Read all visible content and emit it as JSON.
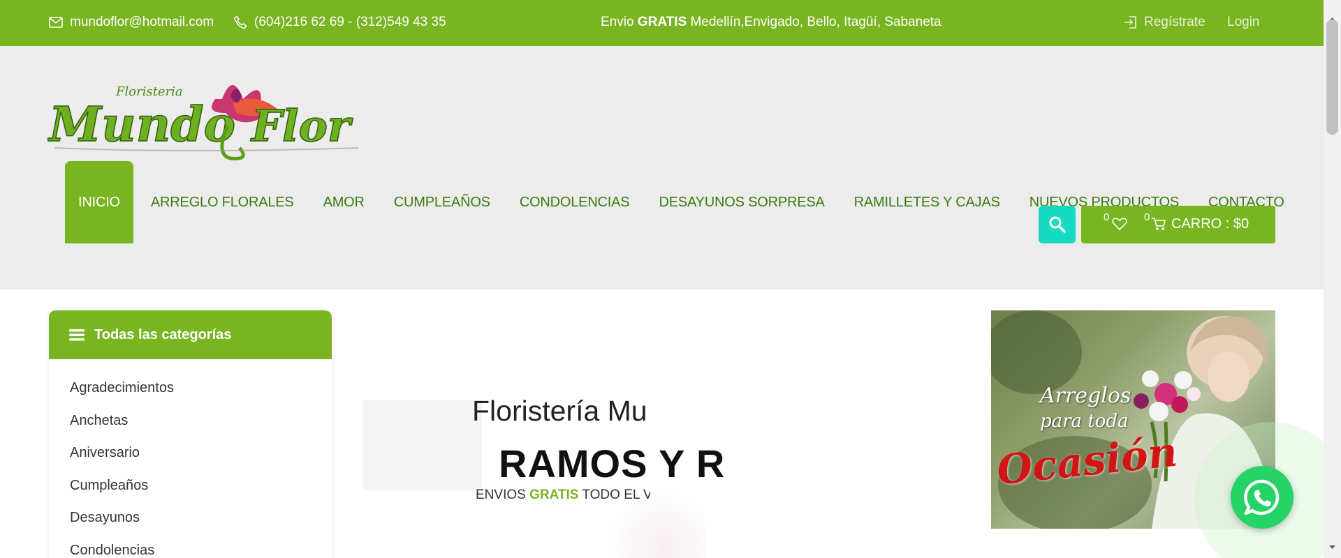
{
  "topbar": {
    "email": "mundoflor@hotmail.com",
    "phone": "(604)216 62 69 - (312)549 43 35",
    "shipping_prefix": "Envio ",
    "shipping_bold": "GRATIS",
    "shipping_rest": " Medellín,Envigado, Bello, Itagüí, Sabaneta",
    "register": "Regístrate",
    "login": "Login"
  },
  "logo": {
    "small": "Floristeria",
    "main_left": "Mundo",
    "main_right": "Flor"
  },
  "nav": {
    "items": [
      {
        "label": "INICIO",
        "active": true
      },
      {
        "label": "ARREGLO FLORALES"
      },
      {
        "label": "AMOR"
      },
      {
        "label": "CUMPLEAÑOS"
      },
      {
        "label": "CONDOLENCIAS"
      },
      {
        "label": "DESAYUNOS SORPRESA"
      },
      {
        "label": "RAMILLETES Y CAJAS"
      },
      {
        "label": "NUEVOS PRODUCTOS"
      },
      {
        "label": "CONTACTO"
      }
    ]
  },
  "cart": {
    "wishlist_count": "0",
    "cart_count": "0",
    "label": "CARRO : $0"
  },
  "categories": {
    "title": "Todas las categorías",
    "items": [
      "Agradecimientos",
      "Anchetas",
      "Aniversario",
      "Cumpleaños",
      "Desayunos",
      "Condolencias"
    ]
  },
  "hero": {
    "title": "Floristería Mundo Flor",
    "subtitle": "RAMOS Y RAMILLETES",
    "tag_prefix": "ENVIOS ",
    "tag_green": "GRATIS",
    "tag_rest": " TODO EL VALLE DE ABURRÁ"
  },
  "promo": {
    "line1": "Arreglos",
    "line2": "para toda",
    "line3": "Ocasión"
  },
  "colors": {
    "brand_green": "#78b521",
    "nav_text": "#3c7a0e",
    "search_teal": "#16dbc0",
    "whatsapp": "#25d366"
  }
}
